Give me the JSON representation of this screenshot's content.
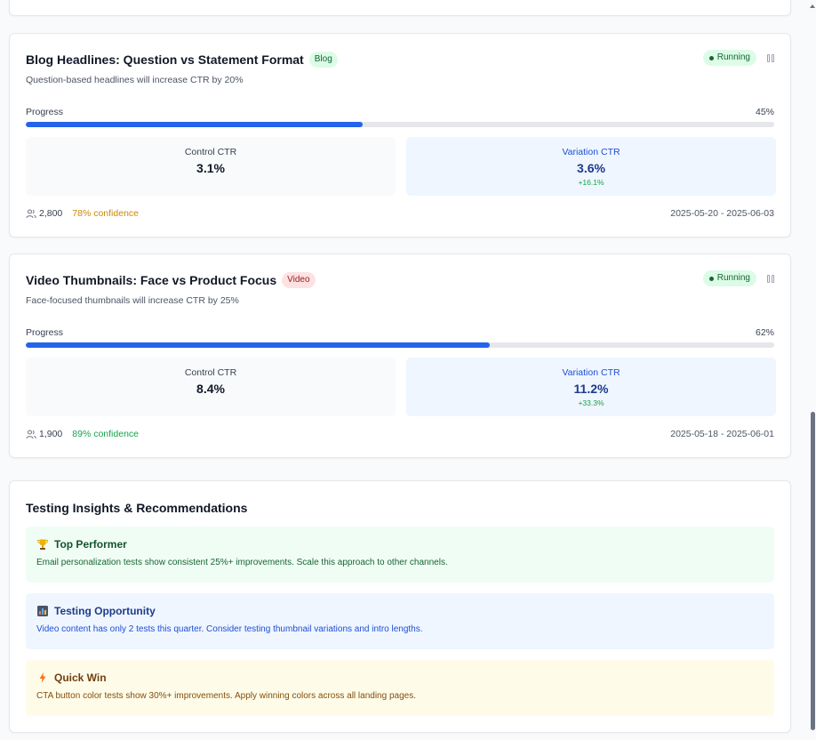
{
  "tests": [
    {
      "title": "Blog Headlines: Question vs Statement Format",
      "tag": "Blog",
      "hypothesis": "Question-based headlines will increase CTR by 20%",
      "status": "Running",
      "progress_label": "Progress",
      "progress_value": "45%",
      "progress_fraction": 0.45,
      "control_label": "Control CTR",
      "control_value": "3.1%",
      "variation_label": "Variation CTR",
      "variation_value": "3.6%",
      "lift": "+16.1%",
      "participants": "2,800",
      "confidence": "78% confidence",
      "dates": "2025-05-20 - 2025-06-03"
    },
    {
      "title": "Video Thumbnails: Face vs Product Focus",
      "tag": "Video",
      "hypothesis": "Face-focused thumbnails will increase CTR by 25%",
      "status": "Running",
      "progress_label": "Progress",
      "progress_value": "62%",
      "progress_fraction": 0.62,
      "control_label": "Control CTR",
      "control_value": "8.4%",
      "variation_label": "Variation CTR",
      "variation_value": "11.2%",
      "lift": "+33.3%",
      "participants": "1,900",
      "confidence": "89% confidence",
      "dates": "2025-05-18 - 2025-06-01"
    }
  ],
  "insights": {
    "title": "Testing Insights & Recommendations",
    "items": [
      {
        "icon": "trophy-icon",
        "heading": "Top Performer",
        "body": "Email personalization tests show consistent 25%+ improvements. Scale this approach to other channels."
      },
      {
        "icon": "bar-chart-icon",
        "heading": "Testing Opportunity",
        "body": "Video content has only 2 tests this quarter. Consider testing thumbnail variations and intro lengths."
      },
      {
        "icon": "lightning-icon",
        "heading": "Quick Win",
        "body": "CTA button color tests show 30%+ improvements. Apply winning colors across all landing pages."
      }
    ]
  },
  "colors": {
    "accent": "#2563eb",
    "running": "#166534",
    "confidence_medium": "#ca8a04",
    "confidence_high": "#16a34a"
  }
}
